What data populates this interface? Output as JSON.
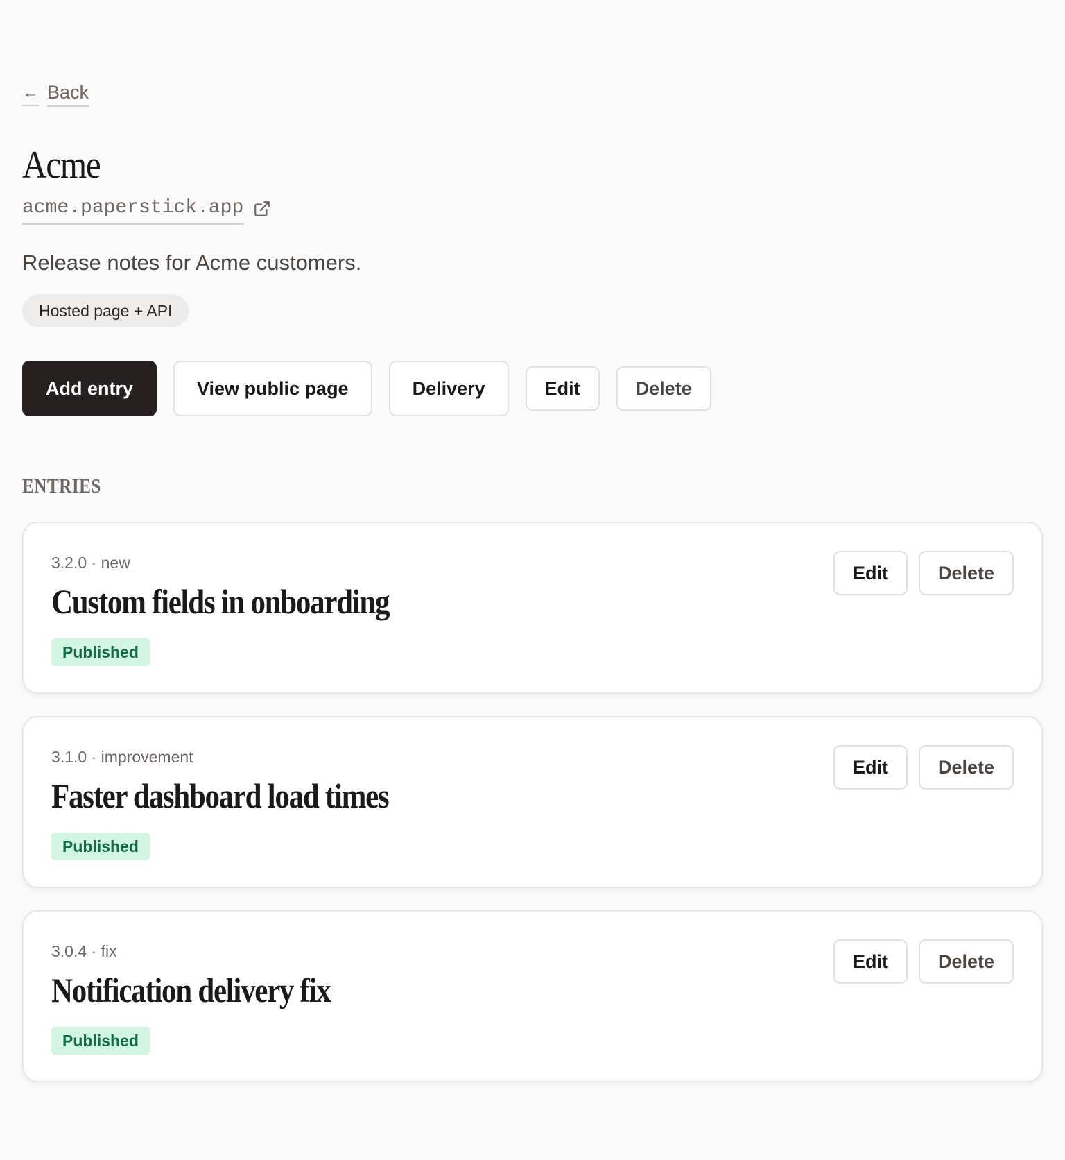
{
  "nav": {
    "back_arrow": "←",
    "back_label": "Back"
  },
  "site": {
    "title": "Acme",
    "domain": "acme.paperstick.app",
    "description": "Release notes for Acme customers.",
    "mode": "Hosted page + API"
  },
  "actions": {
    "add_entry": "Add entry",
    "view_public_page": "View public page",
    "delivery": "Delivery",
    "edit": "Edit",
    "delete": "Delete"
  },
  "entries_heading": "ENTRIES",
  "entries": [
    {
      "version": "3.2.0",
      "type": "new",
      "title": "Custom fields in onboarding",
      "status": "Published",
      "edit_label": "Edit",
      "delete_label": "Delete"
    },
    {
      "version": "3.1.0",
      "type": "improvement",
      "title": "Faster dashboard load times",
      "status": "Published",
      "edit_label": "Edit",
      "delete_label": "Delete"
    },
    {
      "version": "3.0.4",
      "type": "fix",
      "title": "Notification delivery fix",
      "status": "Published",
      "edit_label": "Edit",
      "delete_label": "Delete"
    }
  ],
  "meta_separator": " · ",
  "icons": {
    "external_link": "external-link-icon",
    "back": "arrow-left-icon"
  },
  "colors": {
    "background": "#fafafa",
    "primary_button": "#262120",
    "status_bg": "#d3f5e4",
    "status_text": "#116f44",
    "muted_text": "#6e6763"
  }
}
